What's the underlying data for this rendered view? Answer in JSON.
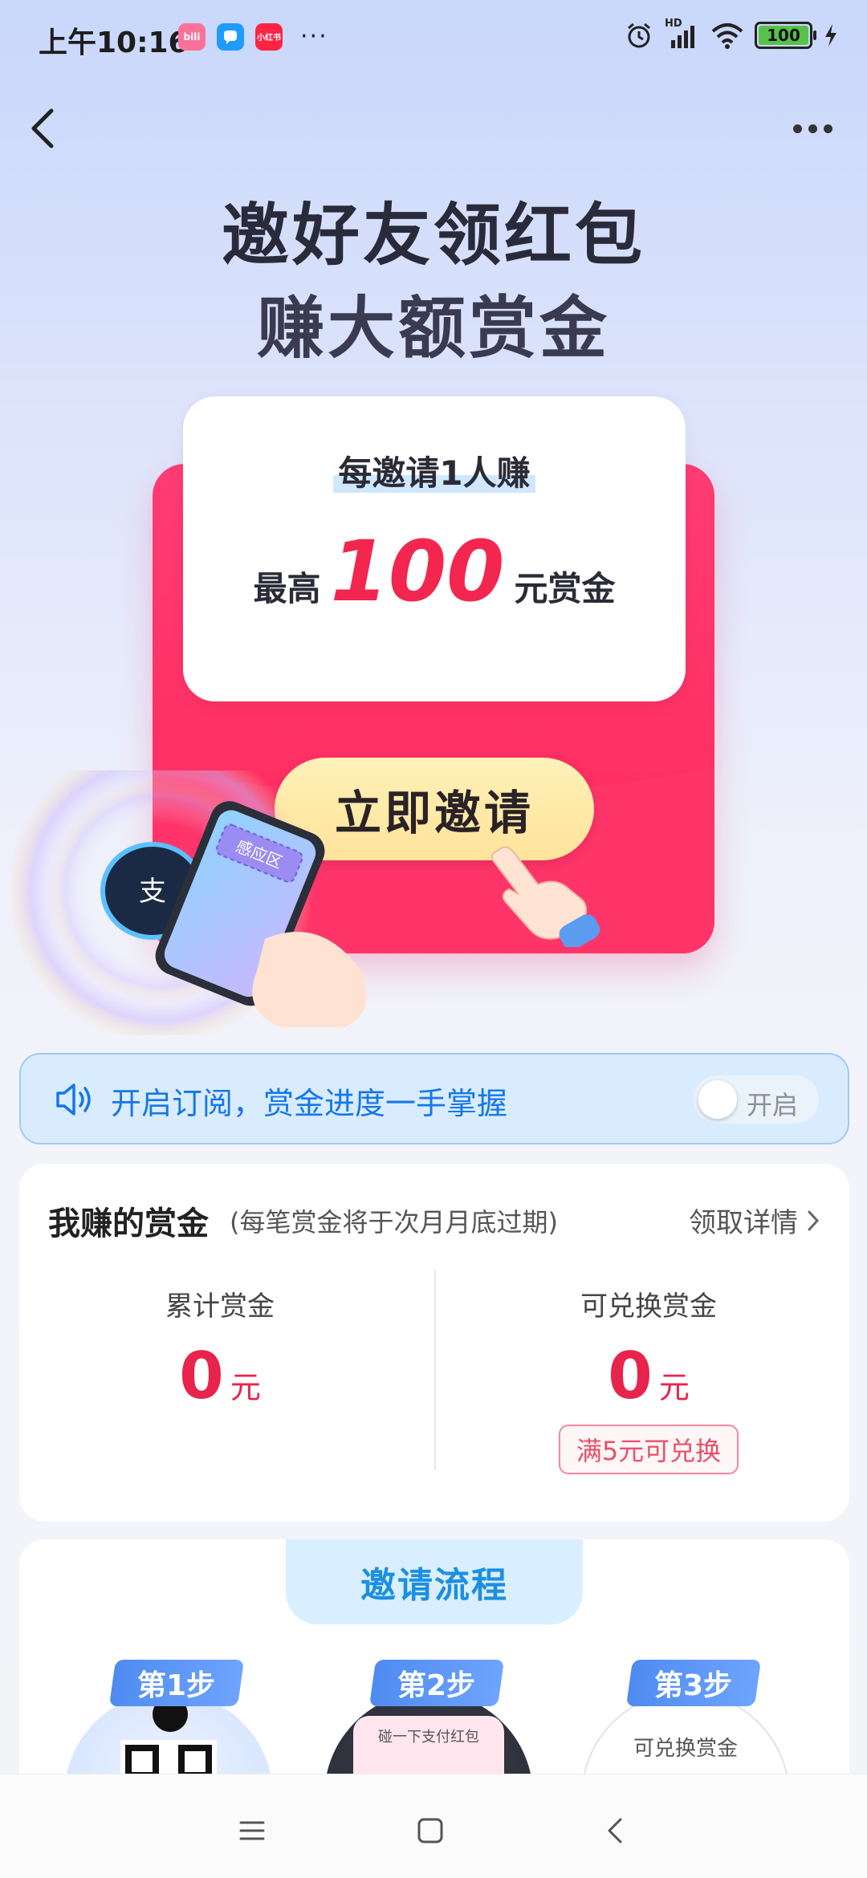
{
  "status_bar": {
    "time": "上午10:16",
    "apps": [
      {
        "name": "bilibili-icon",
        "label": "bili",
        "color": "#fb7299"
      },
      {
        "name": "chat-bubble-icon",
        "label": "",
        "color": "#1e9bff"
      },
      {
        "name": "xiaohongshu-icon",
        "label": "小红书",
        "color": "#ff2442"
      }
    ],
    "more": "···",
    "network": "HD",
    "battery": "100"
  },
  "header": {
    "title_line1": "邀好友领红包",
    "title_line2": "赚大额赏金"
  },
  "envelope": {
    "line1": "每邀请1人赚",
    "prefix": "最高",
    "amount": "100",
    "suffix": "元赏金",
    "button": "立即邀请",
    "sensor_label": "感应区"
  },
  "subscribe": {
    "text": "开启订阅，赏金进度一手掌握",
    "toggle_label": "开启",
    "toggle_on": false
  },
  "bounty": {
    "title": "我赚的赏金",
    "note": "(每笔赏金将于次月月底过期)",
    "detail": "领取详情",
    "left_label": "累计赏金",
    "left_value": "0",
    "left_unit": "元",
    "right_label": "可兑换赏金",
    "right_value": "0",
    "right_unit": "元",
    "right_badge": "满5元可兑换"
  },
  "process": {
    "title": "邀请流程",
    "steps": [
      {
        "label": "第1步",
        "inner": ""
      },
      {
        "label": "第2步",
        "inner": "碰一下支付红包"
      },
      {
        "label": "第3步",
        "inner": "可兑换赏金"
      }
    ]
  },
  "colors": {
    "accent_red": "#f3264f",
    "subscribe_blue": "#1677e8",
    "process_blue": "#1d8fe0"
  }
}
